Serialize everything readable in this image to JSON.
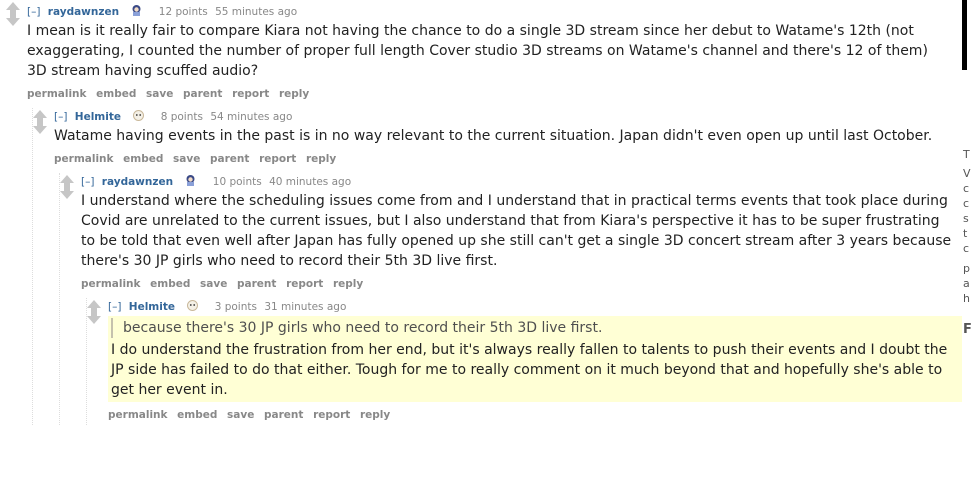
{
  "comments": [
    {
      "expand": "[–]",
      "author": "raydawnzen",
      "score": "12 points",
      "time": "55 minutes ago",
      "body": "I mean is it really fair to compare Kiara not having the chance to do a single 3D stream since her debut to Watame's 12th (not exaggerating, I counted the number of proper full length Cover studio 3D streams on Watame's channel and there's 12 of them) 3D stream having scuffed audio?",
      "buttons": [
        "permalink",
        "embed",
        "save",
        "parent",
        "report",
        "reply"
      ]
    },
    {
      "expand": "[–]",
      "author": "Helmite",
      "score": "8 points",
      "time": "54 minutes ago",
      "body": "Watame having events in the past is in no way relevant to the current situation. Japan didn't even open up until last October.",
      "buttons": [
        "permalink",
        "embed",
        "save",
        "parent",
        "report",
        "reply"
      ]
    },
    {
      "expand": "[–]",
      "author": "raydawnzen",
      "score": "10 points",
      "time": "40 minutes ago",
      "body": "I understand where the scheduling issues come from and I understand that in practical terms events that took place during Covid are unrelated to the current issues, but I also understand that from Kiara's perspective it has to be super frustrating to be told that even well after Japan has fully opened up she still can't get a single 3D concert stream after 3 years because there's 30 JP girls who need to record their 5th 3D live first.",
      "buttons": [
        "permalink",
        "embed",
        "save",
        "parent",
        "report",
        "reply"
      ]
    },
    {
      "expand": "[–]",
      "author": "Helmite",
      "score": "3 points",
      "time": "31 minutes ago",
      "quote": "because there's 30 JP girls who need to record their 5th 3D live first.",
      "body": "I do understand the frustration from her end, but it's always really fallen to talents to push their events and I doubt the JP side has failed to do that either. Tough for me to really comment on it much beyond that and hopefully she's able to get her event in.",
      "buttons": [
        "permalink",
        "embed",
        "save",
        "parent",
        "report",
        "reply"
      ]
    }
  ],
  "sidebar_fragment": [
    "T",
    "V",
    "c",
    "c",
    "s",
    "t",
    "c",
    "p",
    "a",
    "h",
    "F"
  ]
}
